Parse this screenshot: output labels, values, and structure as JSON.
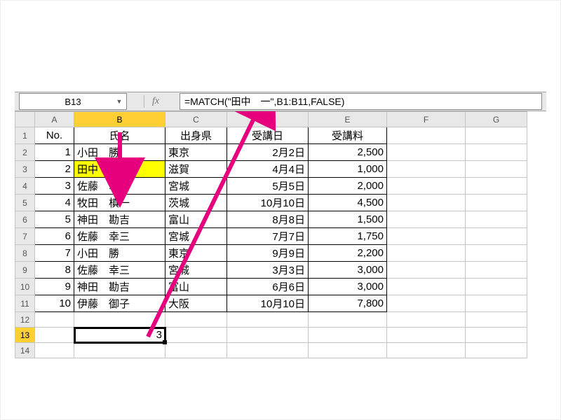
{
  "namebox": {
    "value": "B13"
  },
  "fx_label": "fx",
  "formula": "=MATCH(\"田中　一\",B1:B11,FALSE)",
  "columns": [
    "A",
    "B",
    "C",
    "D",
    "E",
    "F",
    "G"
  ],
  "header_row": {
    "no": "No.",
    "name": "氏名",
    "pref": "出身県",
    "date": "受講日",
    "fee": "受講料"
  },
  "rows": [
    {
      "no": "1",
      "name": "小田　勝",
      "pref": "東京",
      "date": "2月2日",
      "fee": "2,500"
    },
    {
      "no": "2",
      "name": "田中　一",
      "pref": "滋賀",
      "date": "4月4日",
      "fee": "1,000"
    },
    {
      "no": "3",
      "name": "佐藤　幸三",
      "pref": "宮城",
      "date": "5月5日",
      "fee": "2,000"
    },
    {
      "no": "4",
      "name": "牧田　槙一",
      "pref": "茨城",
      "date": "10月10日",
      "fee": "4,500"
    },
    {
      "no": "5",
      "name": "神田　勘吉",
      "pref": "富山",
      "date": "8月8日",
      "fee": "1,500"
    },
    {
      "no": "6",
      "name": "佐藤　幸三",
      "pref": "宮城",
      "date": "7月7日",
      "fee": "1,750"
    },
    {
      "no": "7",
      "name": "小田　勝",
      "pref": "東京",
      "date": "9月9日",
      "fee": "2,200"
    },
    {
      "no": "8",
      "name": "佐藤　幸三",
      "pref": "宮城",
      "date": "3月3日",
      "fee": "3,000"
    },
    {
      "no": "9",
      "name": "神田　勘吉",
      "pref": "富山",
      "date": "6月6日",
      "fee": "3,000"
    },
    {
      "no": "10",
      "name": "伊藤　御子",
      "pref": "大阪",
      "date": "10月10日",
      "fee": "7,800"
    }
  ],
  "result_cell": {
    "ref": "B13",
    "value": "3"
  },
  "colors": {
    "highlight": "#ffff00",
    "arrow": "#e6007e"
  }
}
